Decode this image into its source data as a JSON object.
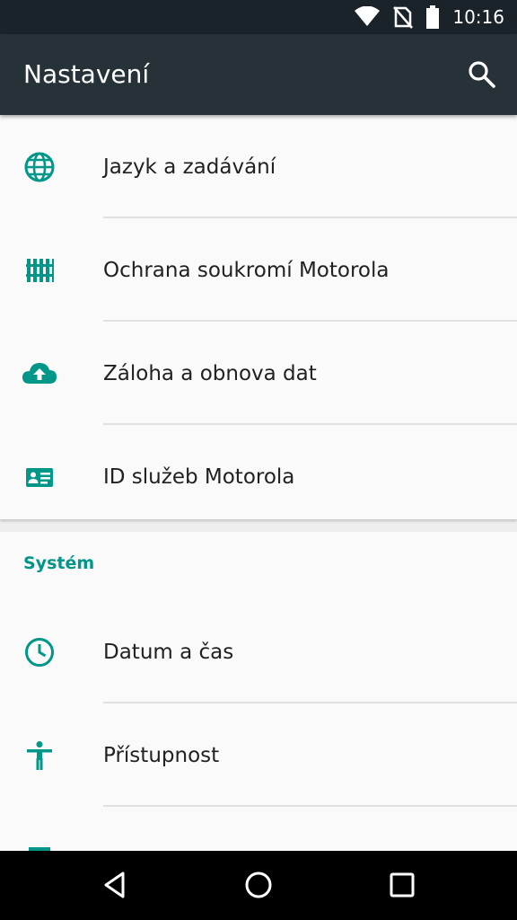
{
  "status_bar": {
    "time": "10:16",
    "icons": [
      "wifi-icon",
      "no-sim-icon",
      "battery-icon"
    ]
  },
  "app_bar": {
    "title": "Nastavení",
    "search_icon": "search-icon"
  },
  "personal_items": [
    {
      "label": "Jazyk a zadávání",
      "icon": "globe-icon"
    },
    {
      "label": "Ochrana soukromí Motorola",
      "icon": "fence-icon"
    },
    {
      "label": "Záloha a obnova dat",
      "icon": "cloud-upload-icon"
    },
    {
      "label": "ID služeb Motorola",
      "icon": "id-card-icon"
    }
  ],
  "system_section": {
    "header": "Systém",
    "items": [
      {
        "label": "Datum a čas",
        "icon": "clock-icon"
      },
      {
        "label": "Přístupnost",
        "icon": "accessibility-icon"
      }
    ]
  },
  "accent_color": "#009688",
  "nav_bar": {
    "buttons": [
      "back-icon",
      "home-icon",
      "recents-icon"
    ]
  }
}
